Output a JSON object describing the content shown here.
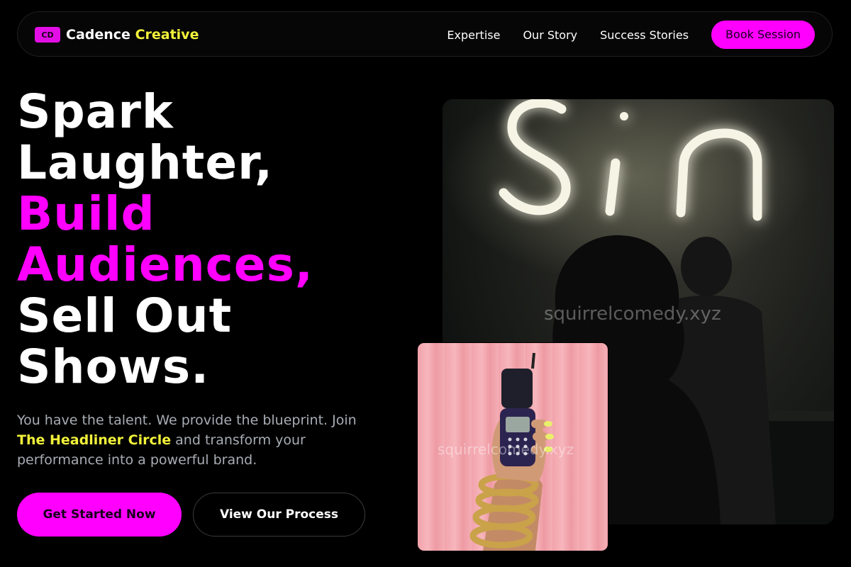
{
  "brand": {
    "badge": "CD",
    "name_part1": "Cadence",
    "name_part2": "Creative"
  },
  "nav": {
    "links": [
      "Expertise",
      "Our Story",
      "Success Stories"
    ],
    "cta": "Book Session"
  },
  "hero": {
    "title_lines": [
      "Spark",
      "Laughter,",
      "Build",
      "Audiences,",
      "Sell Out",
      "Shows."
    ],
    "subtitle_before": "You have the talent. We provide the blueprint. Join",
    "subtitle_highlight": "The Headliner Circle",
    "subtitle_after": "and transform your performance into a powerful brand.",
    "primary_button": "Get Started Now",
    "secondary_button": "View Our Process"
  },
  "images": {
    "main": {
      "neon_text": "Sin",
      "watermark": "squirrelcomedy.xyz"
    },
    "small": {
      "watermark": "squirrelcomedy.xyz"
    }
  },
  "colors": {
    "accent": "#ff00ff",
    "highlight": "#f2f23a",
    "background": "#000000"
  }
}
